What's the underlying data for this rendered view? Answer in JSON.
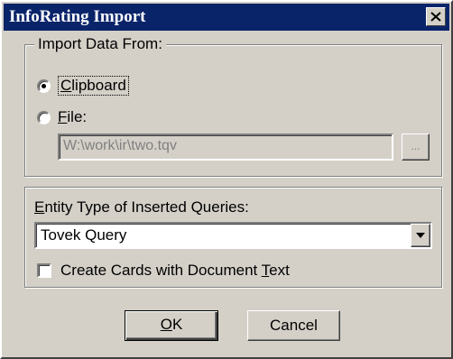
{
  "window": {
    "title": "InfoRating Import"
  },
  "import_group": {
    "legend": "Import Data From:",
    "clipboard": {
      "access_key": "C",
      "rest": "lipboard",
      "checked": true
    },
    "file": {
      "access_key": "F",
      "rest": "ile:",
      "checked": false
    },
    "path_value": "W:\\work\\ir\\two.tqv",
    "browse_label": "..."
  },
  "entity_group": {
    "label_access_key": "E",
    "label_rest": "ntity Type of Inserted Queries:",
    "select_value": "Tovek Query",
    "cards_label_pre": "Create Cards with Document ",
    "cards_label_key": "T",
    "cards_label_post": "ext",
    "cards_checked": false
  },
  "buttons": {
    "ok_key": "O",
    "ok_rest": "K",
    "cancel": "Cancel"
  }
}
